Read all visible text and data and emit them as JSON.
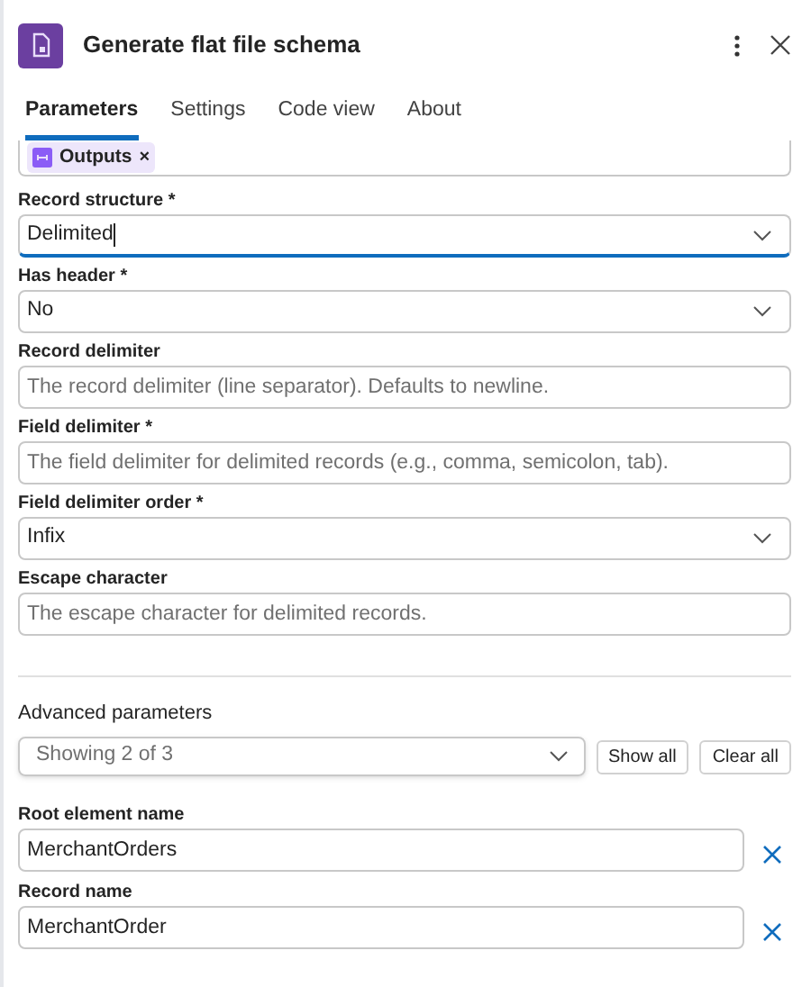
{
  "header": {
    "title": "Generate flat file schema"
  },
  "tabs": [
    {
      "label": "Parameters",
      "selected": true
    },
    {
      "label": "Settings",
      "selected": false
    },
    {
      "label": "Code view",
      "selected": false
    },
    {
      "label": "About",
      "selected": false
    }
  ],
  "token_field": {
    "token": "Outputs",
    "remove": "×"
  },
  "fields": [
    {
      "kind": "dropdown",
      "label": "Record structure *",
      "value": "Delimited",
      "focused": true
    },
    {
      "kind": "dropdown",
      "label": "Has header *",
      "value": "No",
      "focused": false
    },
    {
      "kind": "text",
      "label": "Record delimiter",
      "placeholder": "The record delimiter (line separator). Defaults to newline.",
      "focused": false
    },
    {
      "kind": "text",
      "label": "Field delimiter *",
      "placeholder": "The field delimiter for delimited records (e.g., comma, semicolon, tab).",
      "focused": false
    },
    {
      "kind": "dropdown",
      "label": "Field delimiter order *",
      "value": "Infix",
      "focused": false
    },
    {
      "kind": "text",
      "label": "Escape character",
      "placeholder": "The escape character for delimited records.",
      "focused": false
    }
  ],
  "advanced": {
    "title": "Advanced parameters",
    "dropdown": "Showing 2 of 3",
    "buttons": [
      "Show all",
      "Clear all"
    ],
    "fields": [
      {
        "label": "Root element name",
        "value": "MerchantOrders"
      },
      {
        "label": "Record name",
        "value": "MerchantOrder"
      }
    ]
  }
}
